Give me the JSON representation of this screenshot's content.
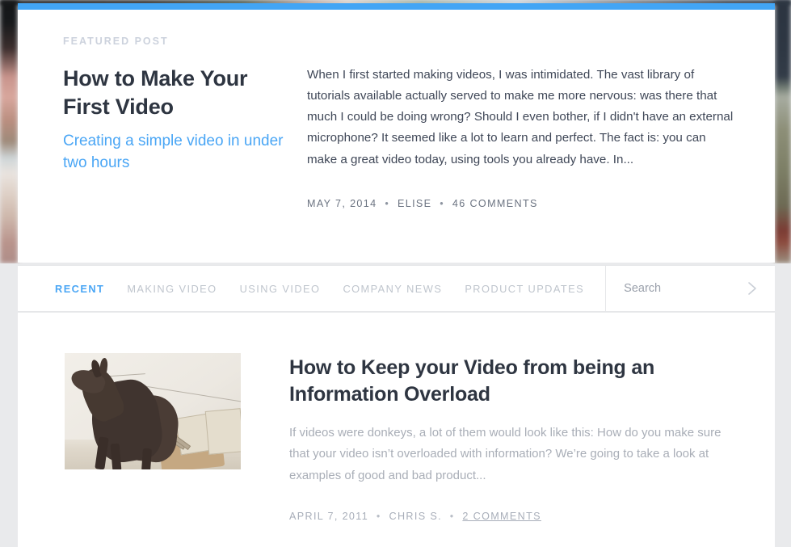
{
  "theme": {
    "accent_color": "#4AA6F5",
    "heading_color": "#2E3541",
    "body_text_color": "#3F4757",
    "muted_text_color": "#A9AEB7",
    "page_background": "#E9EAEC",
    "card_background": "#FFFFFF"
  },
  "featured": {
    "eyebrow": "FEATURED POST",
    "title": "How to Make Your First Video",
    "subtitle": "Creating a simple video in under two hours",
    "excerpt": "When I first started making videos, I was intimidated. The vast library of tutorials available actually served to make me more nervous: was there that much I could be doing wrong? Should I even bother, if I didn't have an external microphone? It seemed like a lot to learn and perfect. The fact is: you can make a great video today, using tools you already have. In...",
    "meta": {
      "date": "MAY 7, 2014",
      "author": "ELISE",
      "comments": "46 COMMENTS",
      "separator": "•"
    }
  },
  "nav": {
    "tabs": [
      {
        "label": "RECENT",
        "active": true
      },
      {
        "label": "MAKING VIDEO",
        "active": false
      },
      {
        "label": "USING VIDEO",
        "active": false
      },
      {
        "label": "COMPANY NEWS",
        "active": false
      },
      {
        "label": "PRODUCT UPDATES",
        "active": false
      }
    ],
    "search": {
      "placeholder": "Search",
      "value": "",
      "submit_icon": "chevron-right-icon"
    }
  },
  "posts": [
    {
      "thumbnail_alt": "donkey-carrying-load-photo",
      "title": "How to Keep your Video from being an Information Overload",
      "excerpt": "If videos were donkeys, a lot of them would look like this: How do you make sure that your video isn’t overloaded with information? We’re going to take a look at examples of good and bad product...",
      "meta": {
        "date": "APRIL 7, 2011",
        "author": "CHRIS S.",
        "comments": "2 COMMENTS",
        "separator": "•"
      }
    }
  ]
}
